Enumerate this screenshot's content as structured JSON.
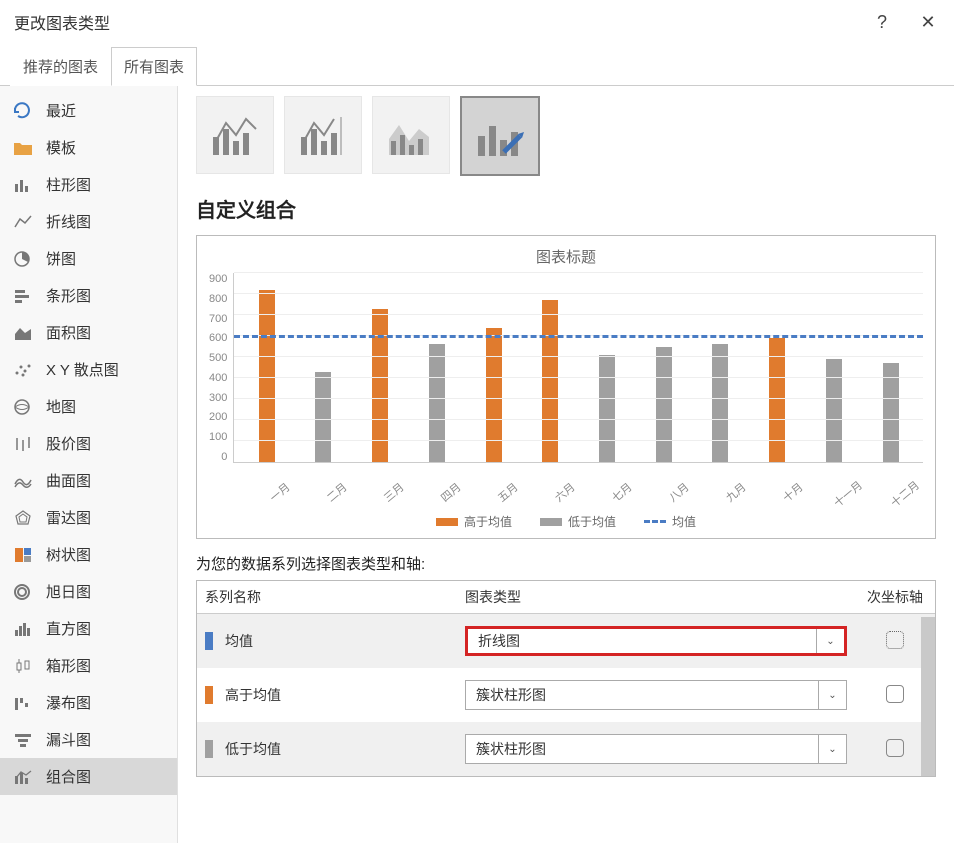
{
  "window": {
    "title": "更改图表类型"
  },
  "tabs": {
    "recommended": "推荐的图表",
    "all": "所有图表"
  },
  "sidebar": {
    "items": [
      {
        "label": "最近"
      },
      {
        "label": "模板"
      },
      {
        "label": "柱形图"
      },
      {
        "label": "折线图"
      },
      {
        "label": "饼图"
      },
      {
        "label": "条形图"
      },
      {
        "label": "面积图"
      },
      {
        "label": "X Y 散点图"
      },
      {
        "label": "地图"
      },
      {
        "label": "股价图"
      },
      {
        "label": "曲面图"
      },
      {
        "label": "雷达图"
      },
      {
        "label": "树状图"
      },
      {
        "label": "旭日图"
      },
      {
        "label": "直方图"
      },
      {
        "label": "箱形图"
      },
      {
        "label": "瀑布图"
      },
      {
        "label": "漏斗图"
      },
      {
        "label": "组合图"
      }
    ]
  },
  "section_title": "自定义组合",
  "chart": {
    "title": "图表标题",
    "legend": {
      "above": "高于均值",
      "below": "低于均值",
      "avg": "均值"
    }
  },
  "series_section": {
    "prompt": "为您的数据系列选择图表类型和轴:",
    "headers": {
      "name": "系列名称",
      "type": "图表类型",
      "secondary": "次坐标轴"
    },
    "rows": [
      {
        "name": "均值",
        "type": "折线图"
      },
      {
        "name": "高于均值",
        "type": "簇状柱形图"
      },
      {
        "name": "低于均值",
        "type": "簇状柱形图"
      }
    ]
  },
  "chart_data": {
    "type": "bar",
    "title": "图表标题",
    "ylabel": "",
    "xlabel": "",
    "ylim": [
      0,
      900
    ],
    "yticks": [
      0,
      100,
      200,
      300,
      400,
      500,
      600,
      700,
      800,
      900
    ],
    "categories": [
      "一月",
      "二月",
      "三月",
      "四月",
      "五月",
      "六月",
      "七月",
      "八月",
      "九月",
      "十月",
      "十一月",
      "十二月"
    ],
    "series": [
      {
        "name": "高于均值",
        "color": "#e07b2e",
        "values": [
          820,
          null,
          730,
          null,
          640,
          770,
          null,
          null,
          null,
          590,
          null,
          null
        ]
      },
      {
        "name": "低于均值",
        "color": "#a0a0a0",
        "values": [
          null,
          430,
          null,
          560,
          null,
          null,
          510,
          550,
          560,
          null,
          490,
          470
        ]
      },
      {
        "name": "均值",
        "chart_type": "line",
        "color": "#4a7cc4",
        "dash": true,
        "values": [
          590,
          590,
          590,
          590,
          590,
          590,
          590,
          590,
          590,
          590,
          590,
          590
        ]
      }
    ]
  }
}
